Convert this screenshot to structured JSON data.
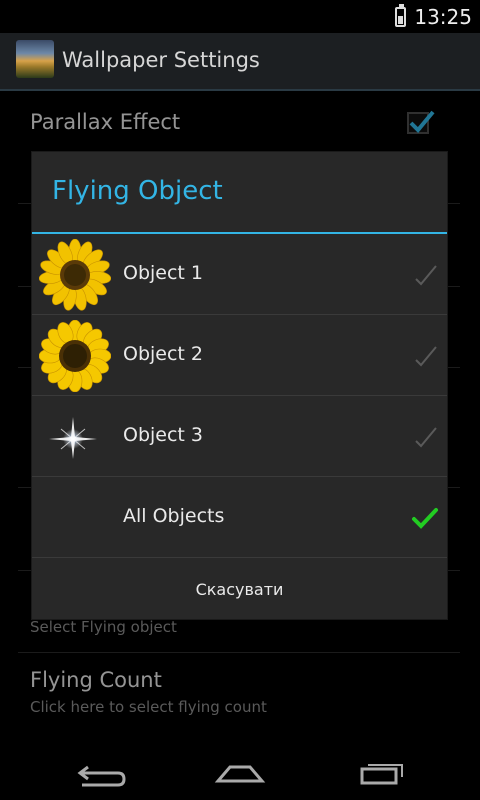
{
  "status_bar": {
    "time": "13:25"
  },
  "action_bar": {
    "title": "Wallpaper Settings"
  },
  "settings": {
    "parallax": {
      "title": "Parallax Effect"
    },
    "flying_object": {
      "summary": "Select Flying object"
    },
    "flying_count": {
      "title": "Flying Count",
      "summary": "Click here to select flying count"
    }
  },
  "dialog": {
    "title": "Flying Object",
    "options": [
      {
        "label": "Object 1",
        "icon": "sunflower-icon",
        "checked": false
      },
      {
        "label": "Object 2",
        "icon": "sunflower-icon",
        "checked": false
      },
      {
        "label": "Object 3",
        "icon": "sparkle-star-icon",
        "checked": false
      },
      {
        "label": "All Objects",
        "icon": null,
        "checked": true
      }
    ],
    "cancel_label": "Скасувати"
  },
  "colors": {
    "accent": "#33b5e5",
    "check_on": "#22cc22",
    "dialog_bg": "#282828"
  }
}
